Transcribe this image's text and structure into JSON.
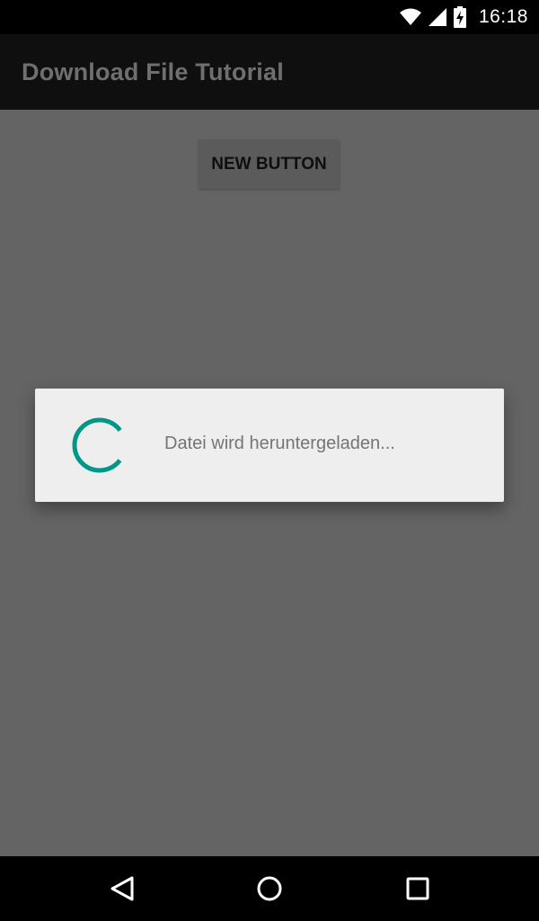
{
  "status_bar": {
    "time": "16:18",
    "icons": [
      "wifi-icon",
      "cell-signal-icon",
      "battery-charging-icon"
    ]
  },
  "app_bar": {
    "title": "Download File Tutorial"
  },
  "main": {
    "button_label": "NEW BUTTON"
  },
  "dialog": {
    "message": "Datei wird heruntergeladen...",
    "spinner_color": "#009688"
  },
  "nav_bar": {
    "icons": [
      "back-icon",
      "home-icon",
      "recents-icon"
    ]
  },
  "colors": {
    "status_bar": "#000000",
    "app_bar": "#0f0f0f",
    "scrim_content": "#646464",
    "dialog_bg": "#eeeeee",
    "accent": "#009688"
  }
}
